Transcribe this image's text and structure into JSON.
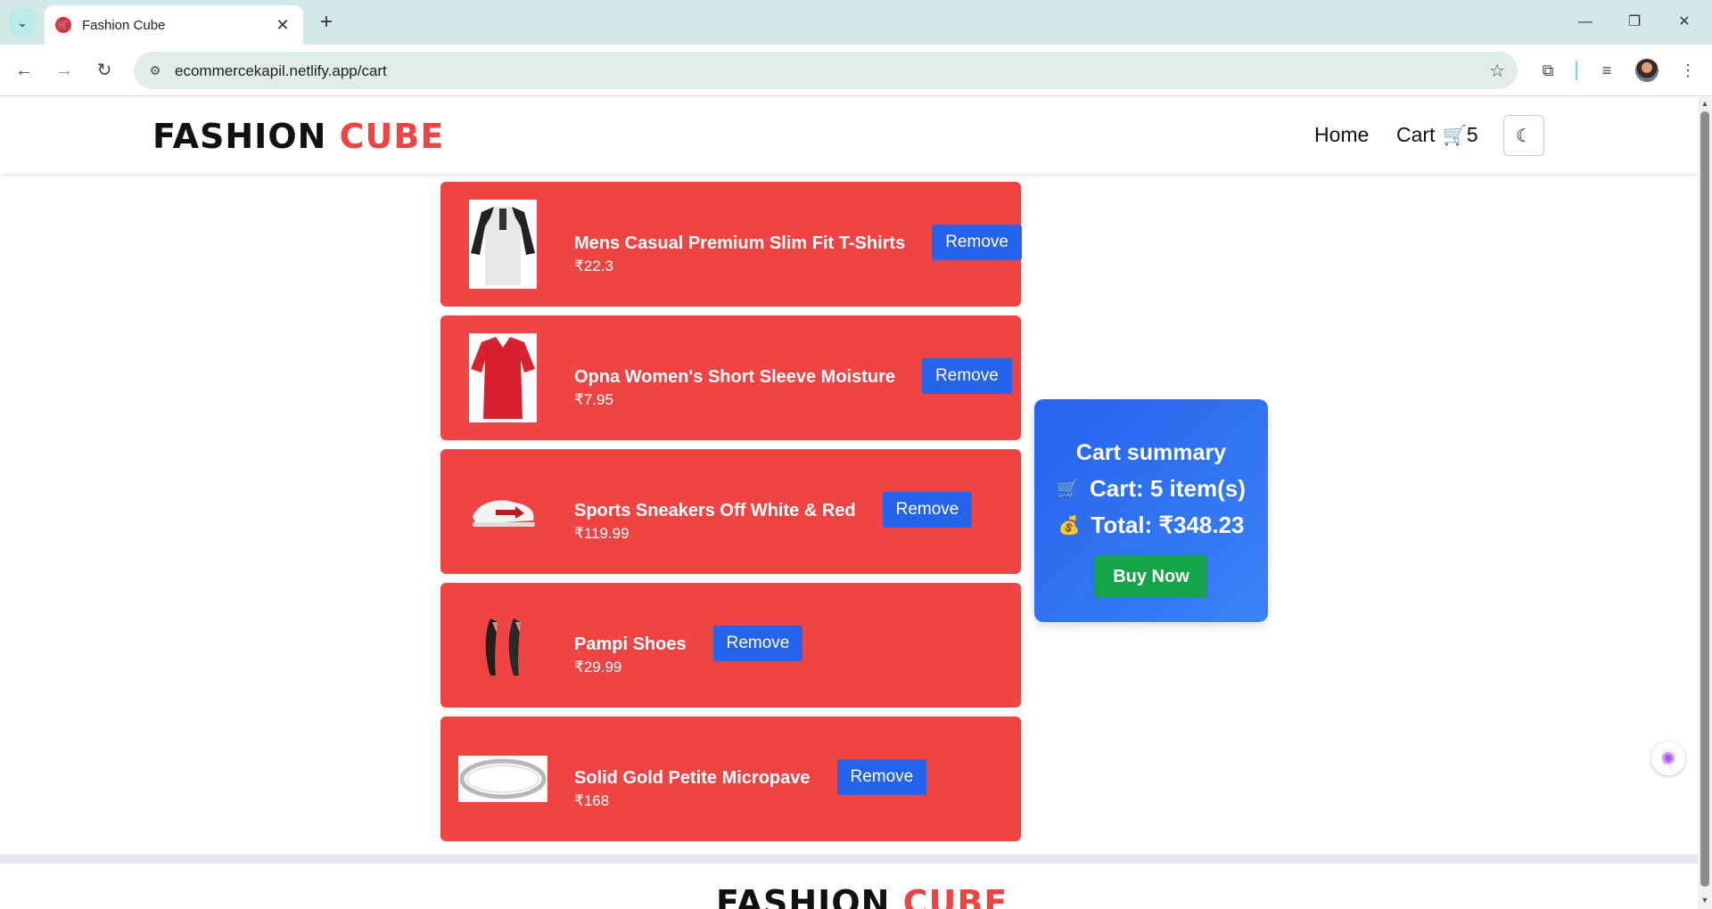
{
  "browser": {
    "tab_title": "Fashion Cube",
    "url": "ecommercekapil.netlify.app/cart"
  },
  "header": {
    "logo_main": "FASHION",
    "logo_accent": "CUBE",
    "nav_home": "Home",
    "nav_cart": "Cart",
    "cart_count": "5"
  },
  "cart": {
    "items": [
      {
        "title": "Mens Casual Premium Slim Fit T-Shirts",
        "price": "₹22.3",
        "remove_label": "Remove",
        "image": "tshirt"
      },
      {
        "title": "Opna Women's Short Sleeve Moisture",
        "price": "₹7.95",
        "remove_label": "Remove",
        "image": "red-shirt"
      },
      {
        "title": "Sports Sneakers Off White & Red",
        "price": "₹119.99",
        "remove_label": "Remove",
        "image": "sneaker"
      },
      {
        "title": "Pampi Shoes",
        "price": "₹29.99",
        "remove_label": "Remove",
        "image": "heels"
      },
      {
        "title": "Solid Gold Petite Micropave",
        "price": "₹168",
        "remove_label": "Remove",
        "image": "bracelet"
      }
    ]
  },
  "summary": {
    "title": "Cart summary",
    "cart_label": "Cart: 5 item(s)",
    "total_label": "Total: ₹348.23",
    "buy_label": "Buy Now"
  },
  "footer": {
    "logo_main": "FASHION",
    "logo_accent": "CUBE"
  },
  "colors": {
    "accent_red": "#ef4444",
    "button_blue": "#2563eb",
    "buy_green": "#16a34a"
  }
}
